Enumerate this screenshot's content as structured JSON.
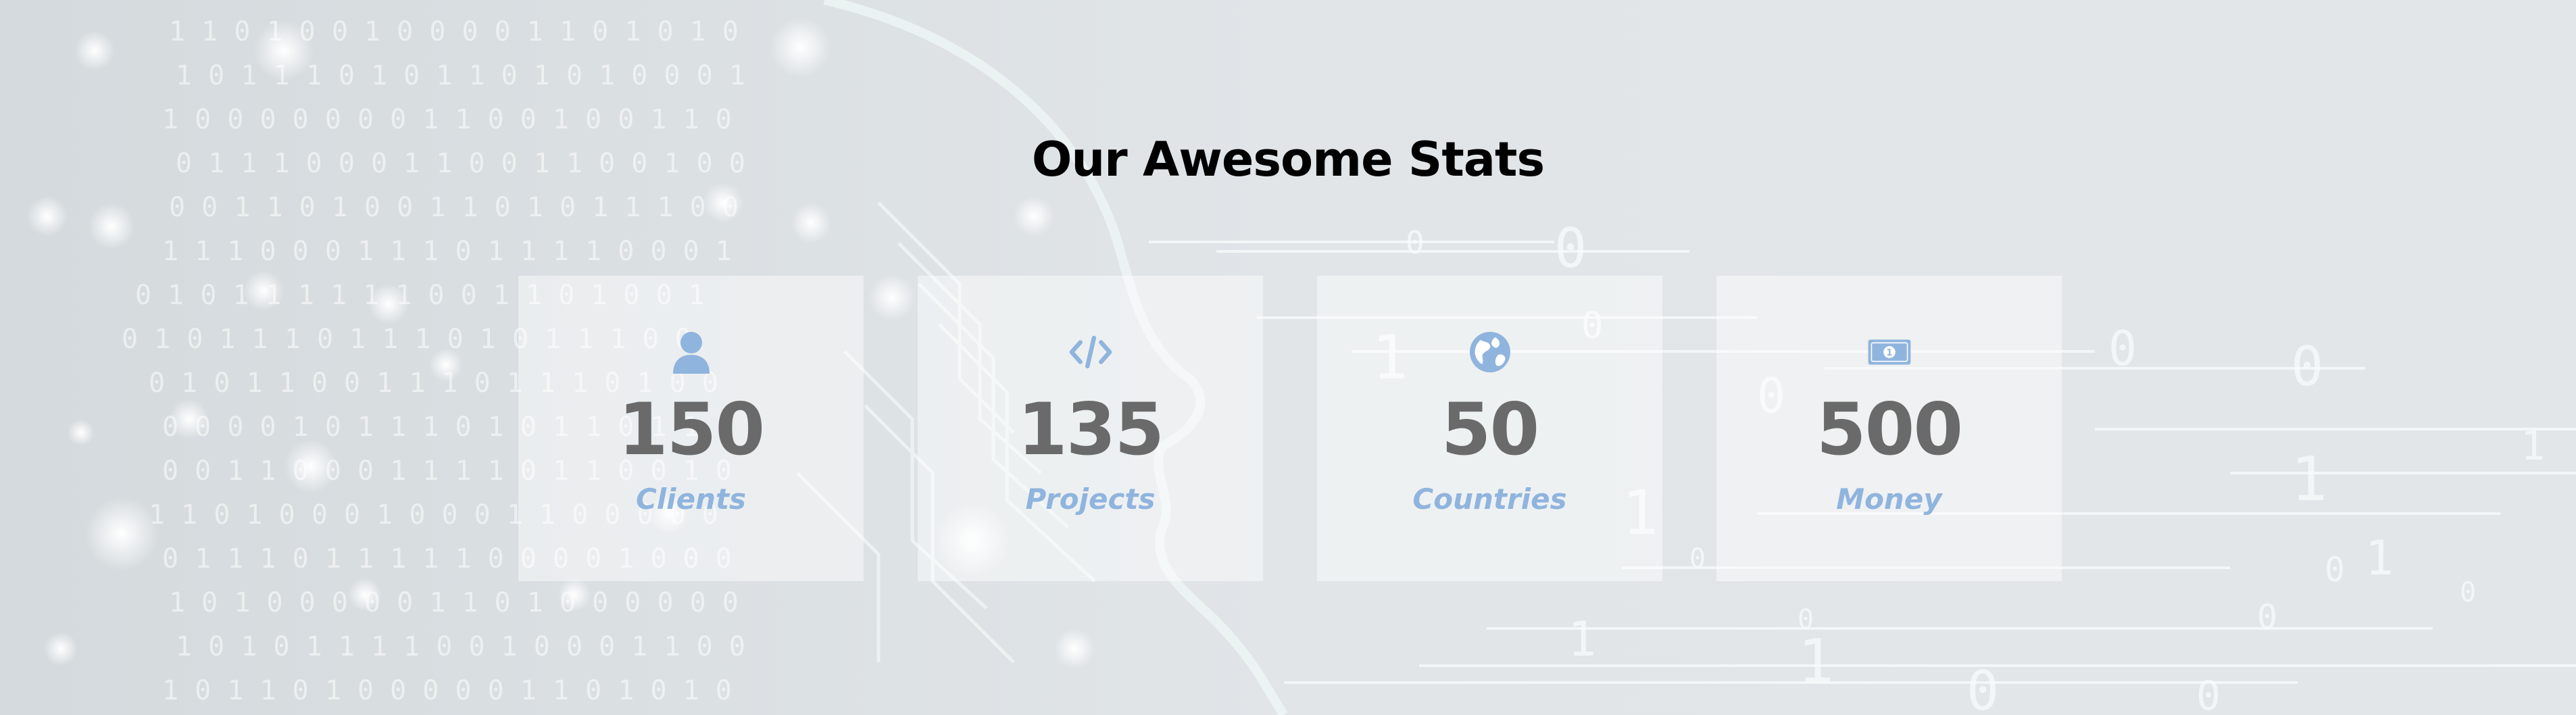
{
  "section": {
    "title": "Our Awesome Stats"
  },
  "colors": {
    "accent": "#8fb4de",
    "number": "#6a6a6a",
    "title": "#000000",
    "background": "#dfe3e6"
  },
  "stats": [
    {
      "icon": "user-icon",
      "value": "150",
      "label": "Clients"
    },
    {
      "icon": "code-icon",
      "value": "135",
      "label": "Projects"
    },
    {
      "icon": "globe-icon",
      "value": "50",
      "label": "Countries"
    },
    {
      "icon": "money-icon",
      "value": "500",
      "label": "Money"
    }
  ]
}
